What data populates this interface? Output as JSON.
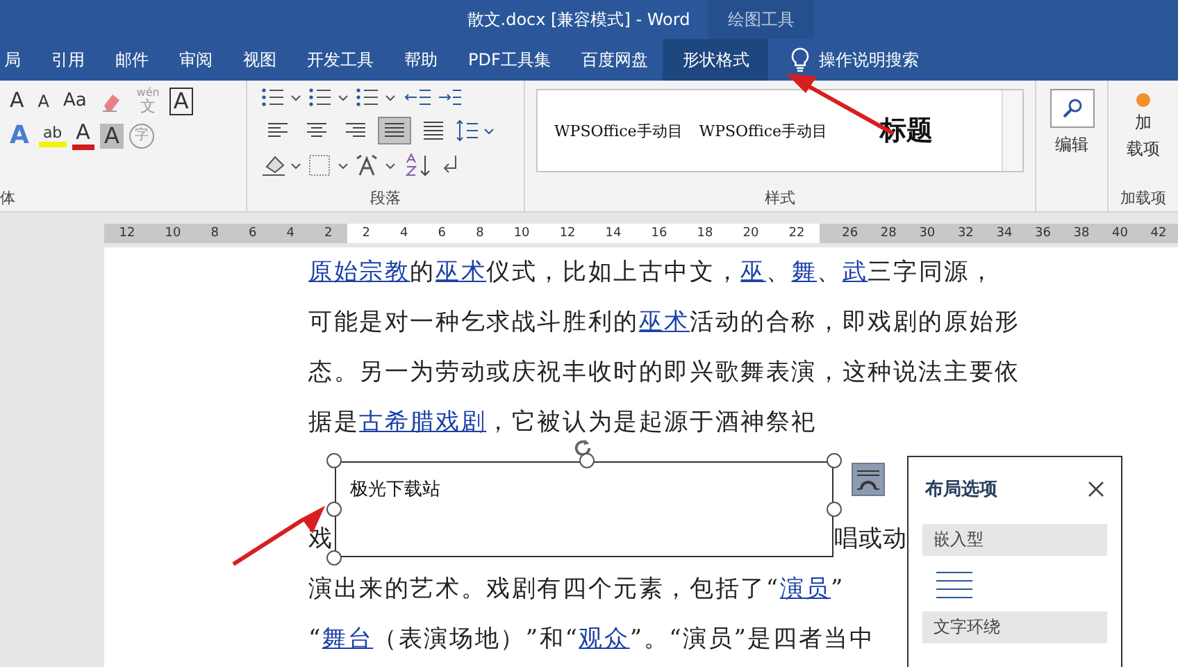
{
  "window": {
    "title": "散文.docx [兼容模式]  -  Word"
  },
  "context_tab_group": {
    "label": "绘图工具"
  },
  "tabs": [
    {
      "label": "局",
      "selected": false
    },
    {
      "label": "引用",
      "selected": false
    },
    {
      "label": "邮件",
      "selected": false
    },
    {
      "label": "审阅",
      "selected": false
    },
    {
      "label": "视图",
      "selected": false
    },
    {
      "label": "开发工具",
      "selected": false
    },
    {
      "label": "帮助",
      "selected": false
    },
    {
      "label": "PDF工具集",
      "selected": false
    },
    {
      "label": "百度网盘",
      "selected": false
    },
    {
      "label": "形状格式",
      "selected": true
    }
  ],
  "tell_me": {
    "label": "操作说明搜索"
  },
  "font_group": {
    "label": "体",
    "row1": [
      {
        "kind": "grow",
        "glyph": "A"
      },
      {
        "kind": "shrink",
        "glyph": "A"
      },
      {
        "kind": "case",
        "glyph": "Aa"
      },
      {
        "kind": "eraser"
      },
      {
        "kind": "phonetic",
        "glyph": "wén",
        "sub": "文"
      },
      {
        "kind": "border",
        "glyph": "A"
      }
    ],
    "row2": [
      {
        "kind": "effect",
        "glyph": "A"
      },
      {
        "kind": "highlight",
        "glyph": "ab"
      },
      {
        "kind": "color",
        "glyph": "A"
      },
      {
        "kind": "shading",
        "glyph": "A"
      },
      {
        "kind": "enclose",
        "glyph": "字"
      }
    ]
  },
  "paragraph_group": {
    "label": "段落",
    "alignments": [
      {
        "kind": "left",
        "selected": false
      },
      {
        "kind": "center",
        "selected": false
      },
      {
        "kind": "right",
        "selected": false
      },
      {
        "kind": "justify",
        "selected": true
      },
      {
        "kind": "distributed",
        "selected": false
      }
    ]
  },
  "styles_group": {
    "label": "样式",
    "items": [
      {
        "kind": "normal",
        "label": "WPSOffice手动目"
      },
      {
        "kind": "normal",
        "label": "WPSOffice手动目"
      },
      {
        "kind": "heading",
        "label": "标题"
      }
    ]
  },
  "editing_group": {
    "button": "编辑"
  },
  "addins_group": {
    "button_lines": [
      "加",
      "载项"
    ],
    "label": "加载项"
  },
  "ruler": {
    "left_ticks": [
      "12",
      "10",
      "8",
      "6",
      "4",
      "2"
    ],
    "ticks": [
      "2",
      "4",
      "6",
      "8",
      "10",
      "12",
      "14",
      "16",
      "18",
      "20",
      "22"
    ],
    "right_ticks": [
      "26",
      "28",
      "30",
      "32",
      "34",
      "36",
      "38",
      "40",
      "42"
    ]
  },
  "document": {
    "lines": [
      {
        "segments": [
          {
            "kind": "link",
            "text": "原始宗教"
          },
          {
            "kind": "text",
            "text": "的"
          },
          {
            "kind": "link",
            "text": "巫术"
          },
          {
            "kind": "text",
            "text": "仪式，比如上古中文，"
          },
          {
            "kind": "link",
            "text": "巫"
          },
          {
            "kind": "text",
            "text": "、"
          },
          {
            "kind": "link",
            "text": "舞"
          },
          {
            "kind": "text",
            "text": "、"
          },
          {
            "kind": "link",
            "text": "武"
          },
          {
            "kind": "text",
            "text": "三字同源，"
          }
        ]
      },
      {
        "segments": [
          {
            "kind": "text",
            "text": "可能是对一种乞求战斗胜利的"
          },
          {
            "kind": "link",
            "text": "巫术"
          },
          {
            "kind": "text",
            "text": "活动的合称，即戏剧的原始形"
          }
        ]
      },
      {
        "segments": [
          {
            "kind": "text",
            "text": "态。另一为劳动或庆祝丰收时的即兴歌舞表演，这种说法主要依"
          }
        ]
      },
      {
        "segments": [
          {
            "kind": "text",
            "text": "据是"
          },
          {
            "kind": "link",
            "text": "古希腊戏剧"
          },
          {
            "kind": "text",
            "text": "，它被认为是起源于酒神祭祀"
          }
        ]
      },
      {
        "kind": "split",
        "segments": [
          {
            "text": "戏"
          },
          {
            "text": "唱或动"
          }
        ]
      },
      {
        "segments": [
          {
            "kind": "text",
            "text": "演出来的艺术。戏剧有四个元素，包括了“"
          },
          {
            "kind": "link",
            "text": "演员"
          },
          {
            "kind": "text",
            "text": "”"
          }
        ]
      },
      {
        "segments": [
          {
            "kind": "text",
            "text": "“"
          },
          {
            "kind": "link",
            "text": "舞台"
          },
          {
            "kind": "text",
            "text": "（表演场地）”和“"
          },
          {
            "kind": "link",
            "text": "观众"
          },
          {
            "kind": "text",
            "text": "”。“演员”是四者当中"
          }
        ]
      }
    ]
  },
  "text_box": {
    "text": "极光下载站"
  },
  "layout_panel": {
    "title": "布局选项",
    "sections": [
      {
        "label": "嵌入型"
      },
      {
        "label": "文字环绕"
      }
    ]
  }
}
